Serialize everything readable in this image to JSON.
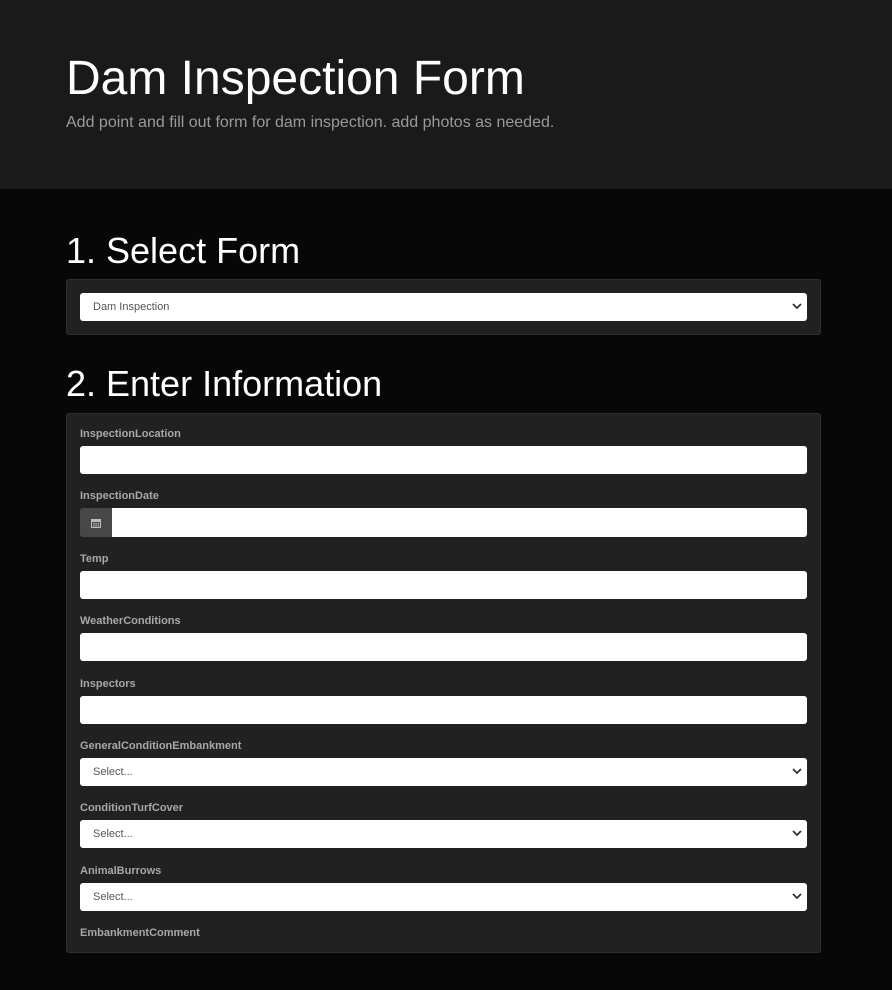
{
  "header": {
    "title": "Dam Inspection Form",
    "subtitle": "Add point and fill out form for dam inspection. add photos as needed."
  },
  "section1": {
    "title": "1. Select Form",
    "form_select": {
      "value": "Dam Inspection"
    }
  },
  "section2": {
    "title": "2. Enter Information",
    "fields": {
      "inspection_location": {
        "label": "InspectionLocation",
        "value": ""
      },
      "inspection_date": {
        "label": "InspectionDate",
        "value": ""
      },
      "temp": {
        "label": "Temp",
        "value": ""
      },
      "weather_conditions": {
        "label": "WeatherConditions",
        "value": ""
      },
      "inspectors": {
        "label": "Inspectors",
        "value": ""
      },
      "general_condition_embankment": {
        "label": "GeneralConditionEmbankment",
        "value": "Select..."
      },
      "condition_turf_cover": {
        "label": "ConditionTurfCover",
        "value": "Select..."
      },
      "animal_burrows": {
        "label": "AnimalBurrows",
        "value": "Select..."
      },
      "embankment_comment": {
        "label": "EmbankmentComment"
      }
    }
  },
  "icons": {
    "calendar": "calendar-icon",
    "chevron": "chevron-down-icon"
  },
  "colors": {
    "header_bg": "#1a1a1a",
    "page_bg": "#070707",
    "panel_bg": "#212121",
    "addon_bg": "#474747"
  }
}
